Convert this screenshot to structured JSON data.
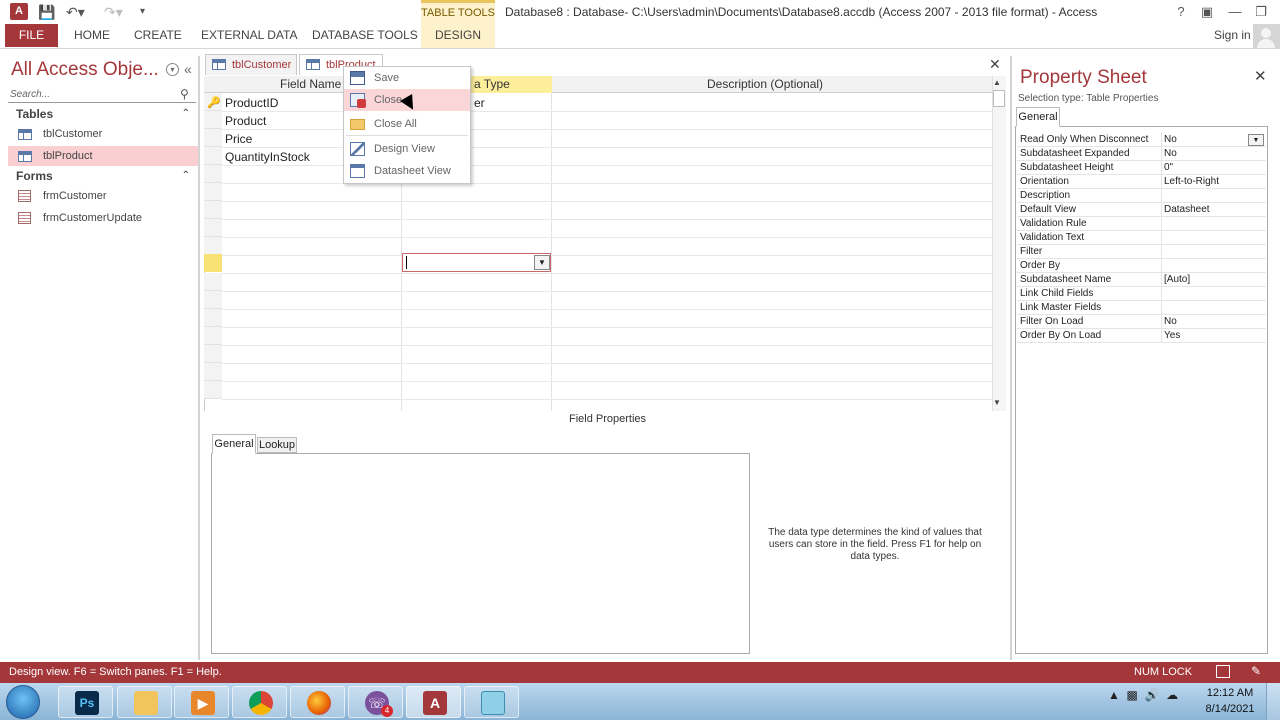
{
  "window": {
    "title": "Database8 : Database- C:\\Users\\admin\\Documents\\Database8.accdb (Access 2007 - 2013 file format) - Access",
    "app_icon_label": "A",
    "context_group": "TABLE TOOLS",
    "help": "?",
    "sign_in": "Sign in"
  },
  "ribbon": {
    "tabs": [
      "FILE",
      "HOME",
      "CREATE",
      "EXTERNAL DATA",
      "DATABASE TOOLS",
      "DESIGN"
    ]
  },
  "nav": {
    "title": "All Access Obje...",
    "search_placeholder": "Search...",
    "groups": [
      {
        "label": "Tables",
        "items": [
          "tblCustomer",
          "tblProduct"
        ]
      },
      {
        "label": "Forms",
        "items": [
          "frmCustomer",
          "frmCustomerUpdate"
        ]
      }
    ],
    "selected": "tblProduct"
  },
  "doc_tabs": [
    "tblCustomer",
    "tblProduct"
  ],
  "design_grid": {
    "headers": [
      "Field Name",
      "Data Type",
      "Description (Optional)"
    ],
    "header_partial": "a Type",
    "fields": [
      "ProductID",
      "Product",
      "Price",
      "QuantityInStock"
    ],
    "partial_type": "er",
    "primary_key": "ProductID"
  },
  "context_menu": {
    "items": [
      "Save",
      "Close",
      "Close All",
      "Design View",
      "Datasheet View"
    ],
    "hovered": "Close"
  },
  "field_properties": {
    "label": "Field Properties",
    "tabs": [
      "General",
      "Lookup"
    ],
    "help": "The data type determines the kind of values that users can store in the field. Press F1 for help on data types."
  },
  "property_sheet": {
    "title": "Property Sheet",
    "selection_type": "Selection type:  Table Properties",
    "tab": "General",
    "rows": [
      {
        "k": "Read Only When Disconnect",
        "v": "No"
      },
      {
        "k": "Subdatasheet Expanded",
        "v": "No"
      },
      {
        "k": "Subdatasheet Height",
        "v": "0\""
      },
      {
        "k": "Orientation",
        "v": "Left-to-Right"
      },
      {
        "k": "Description",
        "v": ""
      },
      {
        "k": "Default View",
        "v": "Datasheet"
      },
      {
        "k": "Validation Rule",
        "v": ""
      },
      {
        "k": "Validation Text",
        "v": ""
      },
      {
        "k": "Filter",
        "v": ""
      },
      {
        "k": "Order By",
        "v": ""
      },
      {
        "k": "Subdatasheet Name",
        "v": "[Auto]"
      },
      {
        "k": "Link Child Fields",
        "v": ""
      },
      {
        "k": "Link Master Fields",
        "v": ""
      },
      {
        "k": "Filter On Load",
        "v": "No"
      },
      {
        "k": "Order By On Load",
        "v": "Yes"
      }
    ]
  },
  "status": {
    "text": "Design view.  F6 = Switch panes.  F1 = Help.",
    "num_lock": "NUM LOCK"
  },
  "taskbar": {
    "apps": [
      "photoshop",
      "file-explorer",
      "media-player",
      "chrome",
      "firefox",
      "viber",
      "access",
      "notepad"
    ],
    "viber_badge": "4",
    "time": "12:12 AM",
    "date": "8/14/2021"
  },
  "colors": {
    "accent": "#a4373a",
    "tool_tab": "#fdf2cc",
    "selection": "#f9cfd2"
  }
}
